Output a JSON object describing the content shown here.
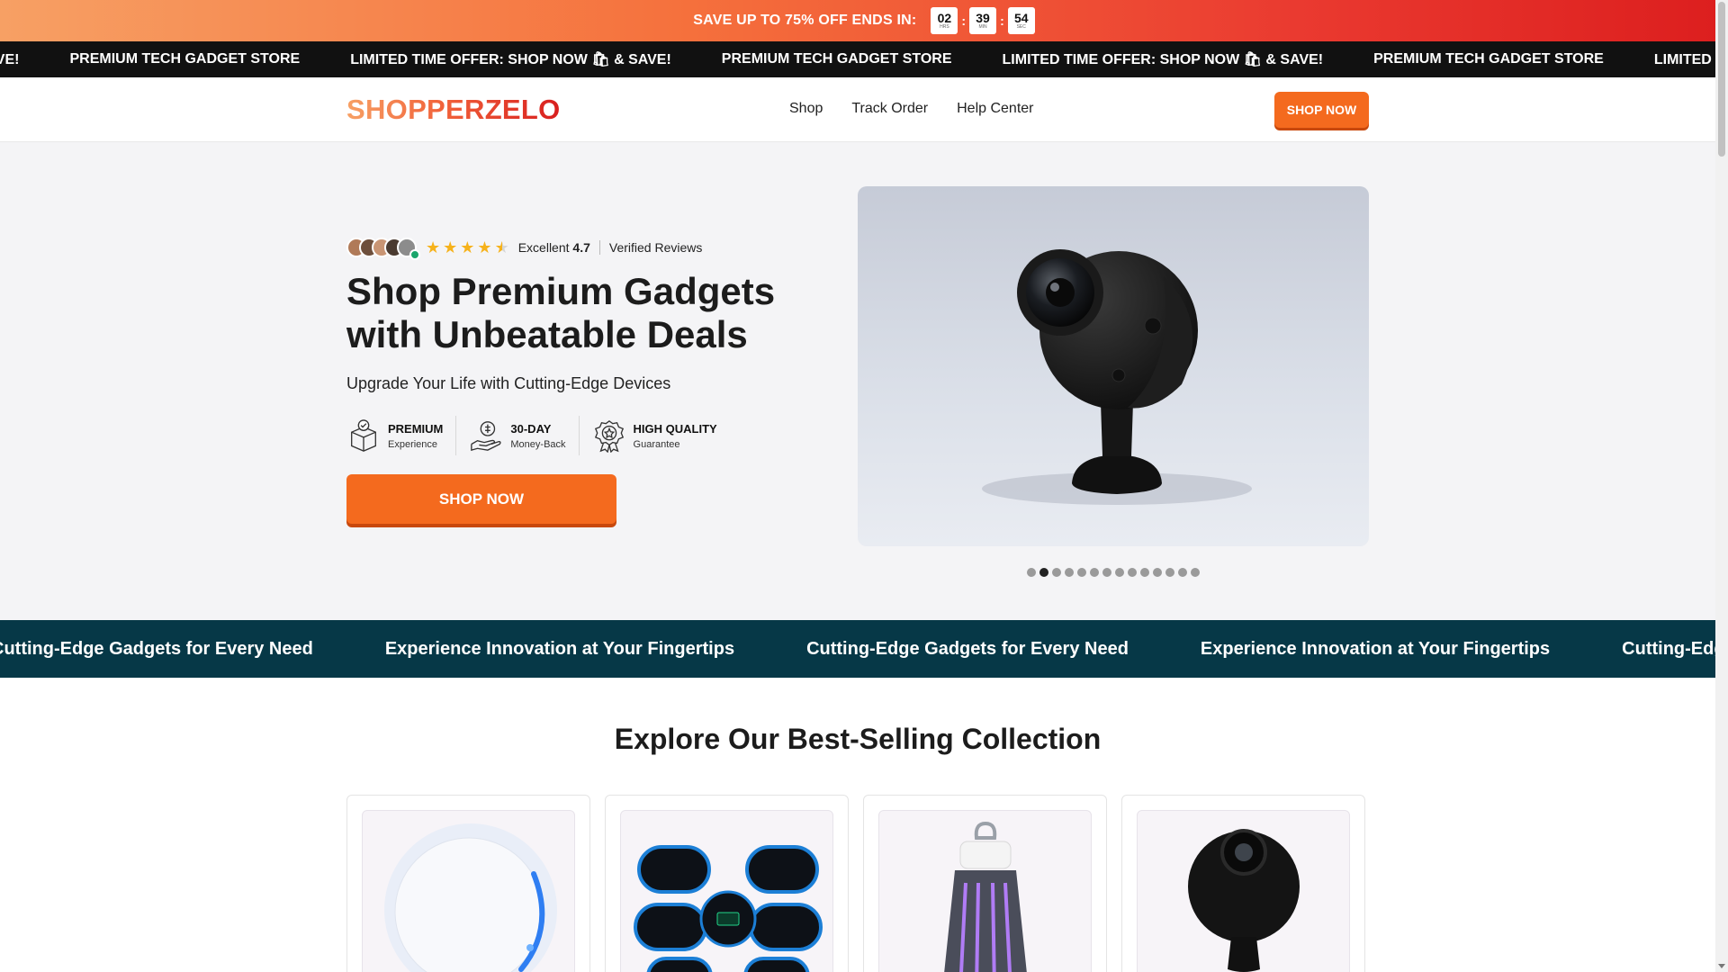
{
  "announcement": {
    "text": "SAVE UP TO 75% OFF ENDS IN:",
    "countdown": [
      {
        "value": "02",
        "unit": "HRS"
      },
      {
        "value": "39",
        "unit": "MIN"
      },
      {
        "value": "54",
        "unit": "SEC"
      }
    ]
  },
  "ticker": {
    "items": [
      "🛍 & SAVE!",
      "PREMIUM TECH GADGET STORE",
      "LIMITED TIME OFFER: SHOP NOW 🛍 & SAVE!",
      "PREMIUM TECH GADGET STORE",
      "LIMITED TIME OFFER: SHOP NOW 🛍 & SAVE!",
      "PREMIUM TECH GADGET STORE",
      "LIMITED TIME OFFER: SHOP NOW 🛍 & SAVE!"
    ]
  },
  "header": {
    "logo": "SHOPPERZELO",
    "nav": [
      "Shop",
      "Track Order",
      "Help Center"
    ],
    "cta": "SHOP NOW"
  },
  "hero": {
    "rating_label": "Excellent",
    "rating_value": "4.7",
    "rating_stars": 4.5,
    "reviews_label": "Verified Reviews",
    "title": "Shop Premium Gadgets with Unbeatable Deals",
    "subtitle": "Upgrade Your Life with Cutting-Edge Devices",
    "features": [
      {
        "title": "PREMIUM",
        "sub": "Experience",
        "icon": "box-check-icon"
      },
      {
        "title": "30-DAY",
        "sub": "Money-Back",
        "icon": "money-hand-icon"
      },
      {
        "title": "HIGH QUALITY",
        "sub": "Guarantee",
        "icon": "quality-badge-icon"
      }
    ],
    "cta": "SHOP NOW",
    "slider": {
      "count": 14,
      "active_index": 1
    }
  },
  "banner": {
    "items": [
      "Cutting-Edge Gadgets for Every Need",
      "Experience Innovation at Your Fingertips",
      "Cutting-Edge Gadgets for Every Need",
      "Experience Innovation at Your Fingertips",
      "Cutting-Edge Gadgets for Every Need"
    ]
  },
  "collection": {
    "title": "Explore Our Best-Selling Collection",
    "products": [
      {
        "image": "white-puck-device"
      },
      {
        "image": "ems-ab-stimulator"
      },
      {
        "image": "bug-zapper-lamp"
      },
      {
        "image": "mini-security-camera"
      }
    ]
  },
  "colors": {
    "accent": "#f46a1e",
    "banner": "#063847",
    "ticker": "#111111",
    "star": "#f6b21b"
  }
}
